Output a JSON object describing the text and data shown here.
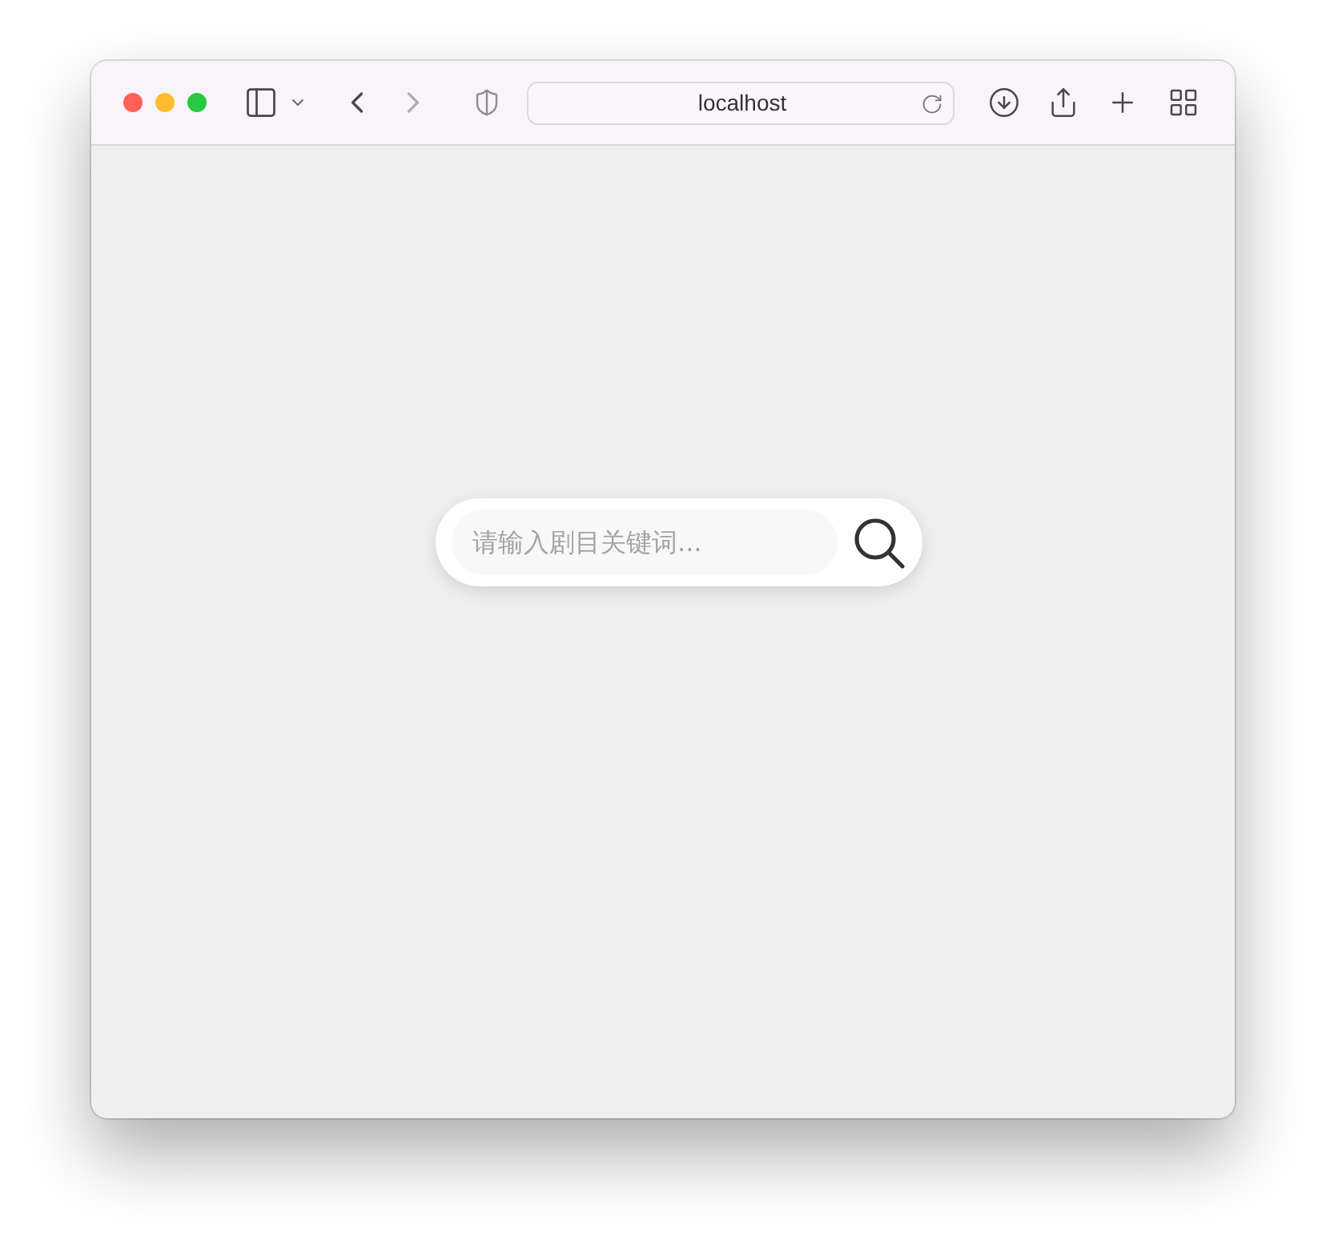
{
  "browser": {
    "address": "localhost",
    "navigation": {
      "back": {
        "disabled": false
      },
      "forward": {
        "disabled": true
      }
    }
  },
  "search": {
    "placeholder": "请输入剧目关键词..."
  }
}
